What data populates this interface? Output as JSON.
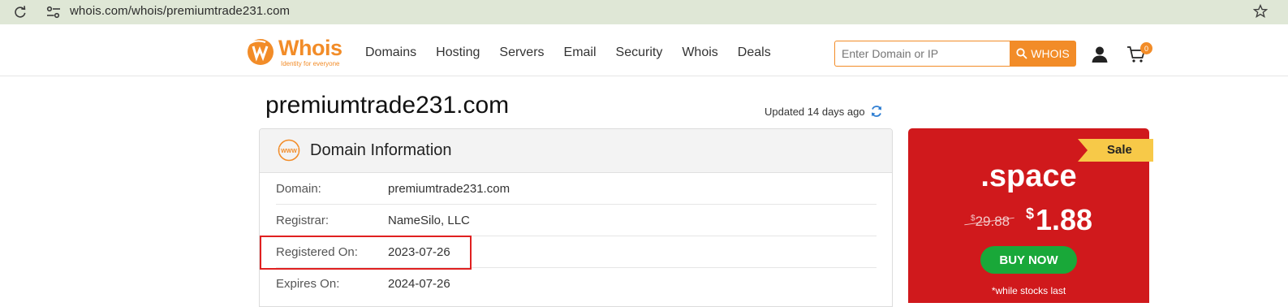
{
  "browser": {
    "url": "whois.com/whois/premiumtrade231.com"
  },
  "header": {
    "logo_text": "Whois",
    "logo_tagline": "Identity for everyone",
    "nav": [
      "Domains",
      "Hosting",
      "Servers",
      "Email",
      "Security",
      "Whois",
      "Deals"
    ],
    "search_placeholder": "Enter Domain or IP",
    "search_button": "WHOIS",
    "cart_count": "0"
  },
  "main": {
    "domain_title": "premiumtrade231.com",
    "updated_text": "Updated 14 days ago",
    "info_card": {
      "title": "Domain Information",
      "rows": [
        {
          "label": "Domain:",
          "value": "premiumtrade231.com"
        },
        {
          "label": "Registrar:",
          "value": "NameSilo, LLC"
        },
        {
          "label": "Registered On:",
          "value": "2023-07-26"
        },
        {
          "label": "Expires On:",
          "value": "2024-07-26"
        }
      ]
    }
  },
  "promo": {
    "badge": "Sale",
    "tld": ".space",
    "old_currency": "$",
    "old_price": "29.88",
    "new_currency": "$",
    "new_price": "1.88",
    "button": "BUY NOW",
    "note": "*while stocks last"
  },
  "colors": {
    "brand_orange": "#f28c28",
    "promo_red": "#d0191c",
    "buy_green": "#19a839",
    "highlight_red": "#e02020",
    "sale_yellow": "#f7c948"
  }
}
